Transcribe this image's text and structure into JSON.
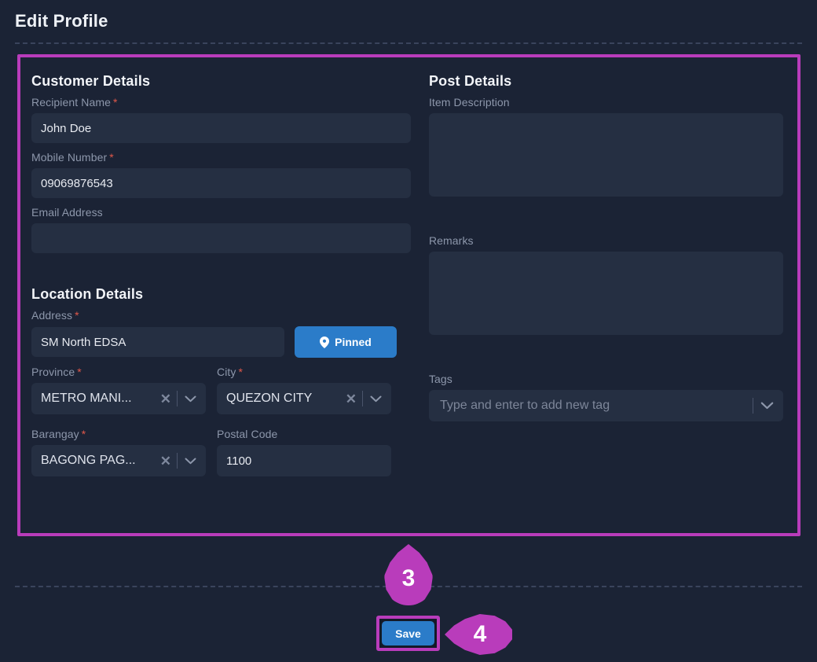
{
  "header": {
    "title": "Edit Profile"
  },
  "colors": {
    "page_background": "#1b2335",
    "input_background": "#252f42",
    "accent_blue": "#2b7cc9",
    "highlight_magenta": "#b93cbb",
    "required_red": "#e0584a",
    "label_grey": "#8d97ab"
  },
  "customer_details": {
    "section_title": "Customer Details",
    "recipient_name": {
      "label": "Recipient Name",
      "required_marker": "*",
      "value": "John Doe",
      "placeholder": ""
    },
    "mobile_number": {
      "label": "Mobile Number",
      "required_marker": "*",
      "value": "09069876543",
      "placeholder": ""
    },
    "email_address": {
      "label": "Email Address",
      "value": "",
      "placeholder": ""
    }
  },
  "location_details": {
    "section_title": "Location Details",
    "address": {
      "label": "Address",
      "required_marker": "*",
      "value": "SM North EDSA",
      "placeholder": ""
    },
    "pin_button": {
      "label": "Pinned",
      "icon": "map-pin-icon"
    },
    "province": {
      "label": "Province",
      "required_marker": "*",
      "value": "METRO MANI...",
      "clear_icon": "clear-x-icon",
      "chevron_icon": "chevron-down-icon"
    },
    "city": {
      "label": "City",
      "required_marker": "*",
      "value": "QUEZON CITY",
      "clear_icon": "clear-x-icon",
      "chevron_icon": "chevron-down-icon"
    },
    "barangay": {
      "label": "Barangay",
      "required_marker": "*",
      "value": "BAGONG PAG...",
      "clear_icon": "clear-x-icon",
      "chevron_icon": "chevron-down-icon"
    },
    "postal_code": {
      "label": "Postal Code",
      "value": "1100",
      "placeholder": ""
    }
  },
  "post_details": {
    "section_title": "Post Details",
    "item_description": {
      "label": "Item Description",
      "value": "",
      "placeholder": ""
    },
    "remarks": {
      "label": "Remarks",
      "value": "",
      "placeholder": ""
    },
    "tags": {
      "label": "Tags",
      "value": "",
      "placeholder": "Type and enter to add new tag",
      "chevron_icon": "chevron-down-icon"
    }
  },
  "footer": {
    "save_label": "Save"
  },
  "annotations": {
    "step_form": "3",
    "step_save": "4"
  }
}
